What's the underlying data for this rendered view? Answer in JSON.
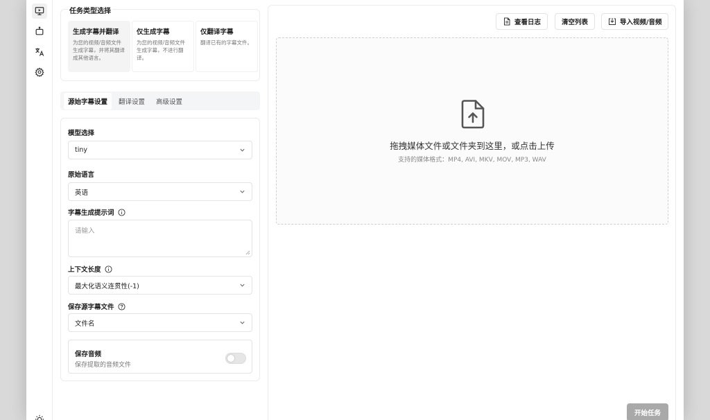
{
  "task_type": {
    "title": "任务类型选择",
    "options": [
      {
        "title": "生成字幕并翻译",
        "desc": "为您的视频/音频文件生成字幕，并将其翻译成其他语言。",
        "selected": true
      },
      {
        "title": "仅生成字幕",
        "desc": "为您的视频/音频文件生成字幕，不进行翻译。",
        "selected": false
      },
      {
        "title": "仅翻译字幕",
        "desc": "翻译已有的字幕文件。",
        "selected": false
      }
    ]
  },
  "tabs": [
    "源始字幕设置",
    "翻译设置",
    "高级设置"
  ],
  "settings": {
    "model_label": "模型选择",
    "model_value": "tiny",
    "language_label": "原始语言",
    "language_value": "英语",
    "prompt_label": "字幕生成提示词",
    "prompt_placeholder": "请输入",
    "context_label": "上下文长度",
    "context_value": "最大化语义连贯性(-1)",
    "save_source_label": "保存源字幕文件",
    "save_source_value": "文件名",
    "save_audio_title": "保存音频",
    "save_audio_desc": "保存提取的音频文件",
    "save_audio_enabled": false
  },
  "toolbar": {
    "view_log": "查看日志",
    "clear_list": "清空列表",
    "import_media": "导入视频/音频"
  },
  "dropzone": {
    "title": "拖拽媒体文件或文件夹到这里，或点击上传",
    "formats": "支持的媒体格式：MP4, AVI, MKV, MOV, MP3, WAV"
  },
  "start_button": "开始任务",
  "icons": [
    "monitor-play-icon",
    "bot-icon",
    "translate-icon",
    "gear-icon",
    "sun-icon"
  ]
}
